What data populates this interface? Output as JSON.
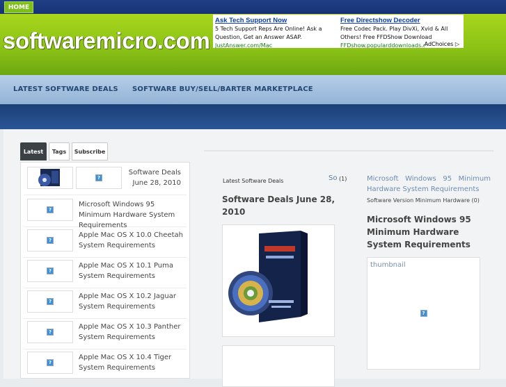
{
  "topbar": {
    "home_label": "HOME"
  },
  "header": {
    "logo": "softwaremicro.com"
  },
  "ad": {
    "items": [
      {
        "title": "Ask Tech Support Now",
        "text": "5 Tech Support Reps Are Online! Ask a Question, Get an Answer ASAP.",
        "url": "JustAnswer.com/Mac"
      },
      {
        "title": "Free Directshow Decoder",
        "text": "Free Codec Pack. Play DivXi, Xvid & All Others! Free FFDShow Download",
        "url": "FFDshow.popularddownloads.com"
      }
    ],
    "adchoices": "AdChoices"
  },
  "nav": {
    "items": [
      "LATEST SOFTWARE DEALS",
      "SOFTWARE BUY/SELL/BARTER MARKETPLACE"
    ]
  },
  "sidebar": {
    "tabs": [
      "Latest",
      "Tags",
      "Subscribe"
    ],
    "items": [
      {
        "title": "Software Deals June 28, 2010"
      },
      {
        "title": "Microsoft Windows 95 Minimum Hardware System Requirements"
      },
      {
        "title": "Apple Mac OS X 10.0 Cheetah System Requirements"
      },
      {
        "title": "Apple Mac OS X 10.1 Puma System Requirements"
      },
      {
        "title": "Apple Mac OS X 10.2 Jaguar System Requirements"
      },
      {
        "title": "Apple Mac OS X 10.3 Panther System Requirements"
      },
      {
        "title": "Apple Mac OS X 10.4 Tiger System Requirements"
      }
    ]
  },
  "post": {
    "label": "Latest Software Deals",
    "title": "Software Deals June 28, 2010",
    "so_label": "So",
    "so_count": "(1)"
  },
  "right": {
    "link": "Microsoft Windows 95 Minimum Hardware System Requirements",
    "snippet": "Software Version Minimum Hardware (0)",
    "title": "Microsoft Windows 95 Minimum Hardware System Requirements",
    "thumb_label": "thumbnail"
  },
  "colors": {
    "header_green": "#89c116",
    "nav_blue": "#93b3d6",
    "band_blue": "#1c3f78",
    "home_green": "#7ebf19"
  },
  "icons": {
    "missing_image": "broken-image-icon"
  }
}
